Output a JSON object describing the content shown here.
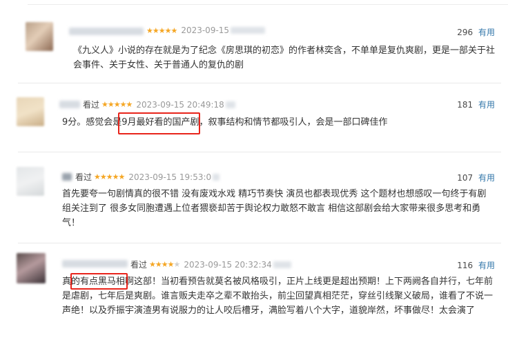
{
  "reviews": [
    {
      "status": "",
      "stars": 5,
      "date": "2023-09-15",
      "votes": "296",
      "vote_label": "有用",
      "text": "《九义人》小说的存在就是为了纪念《房思琪的初恋》的作者林奕含，不单单是复仇爽剧，更是一部关于社会事件、关于女性、关于普通人的复仇的剧"
    },
    {
      "status": "看过",
      "stars": 5,
      "date": "2023-09-15 20:49:18",
      "votes": "181",
      "vote_label": "有用",
      "text": "9分。感觉会是9月最好看的国产剧，叙事结构和情节都吸引人，会是一部口碑佳作"
    },
    {
      "status": "看过",
      "stars": 5,
      "date": "2023-09-15 19:53:0",
      "votes": "107",
      "vote_label": "有用",
      "text": "首先要夸一句剧情真的很不错 没有废戏水戏 精巧节奏快 演员也都表现优秀 这个题材也想感叹一句终于有剧组关注到了 很多女同胞遭遇上位者猥亵却苦于舆论权力敢怒不敢言 相信这部剧会给大家带来很多思考和勇气！"
    },
    {
      "status": "看过",
      "stars": 4,
      "date": "2023-09-15 20:32:34",
      "votes": "116",
      "vote_label": "有用",
      "text": "真的有点黑马相啊这部！当初看预告就莫名被风格吸引，正片上线更是超出预期！上下两阙各自并行，七年前是虐剧，七年后是爽剧。谁言贩夫走卒之辈不敢抬头，前尘回望真相茫茫，穿丝引线聚义破局，谁看了不说一声绝！以及乔振宇演渣男有说服力的让人咬后槽牙，满脸写着八个大字，道貌岸然，坏事做尽！太会演了"
    }
  ]
}
